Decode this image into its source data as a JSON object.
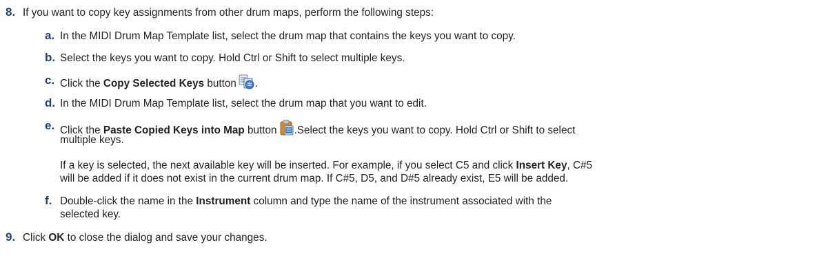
{
  "step8": {
    "num": "8.",
    "text": "If you want to copy key assignments from other drum maps, perform the following steps:"
  },
  "substeps": {
    "a": {
      "letter": "a.",
      "text": "In the MIDI Drum Map Template list, select the drum map that contains the keys you want to copy."
    },
    "b": {
      "letter": "b.",
      "text": "Select the keys you want to copy. Hold Ctrl or Shift to select multiple keys."
    },
    "c": {
      "letter": "c.",
      "pre": "Click the ",
      "bold": "Copy Selected Keys",
      "post": " button",
      "end": ".",
      "icon": "copy-keys-icon"
    },
    "d": {
      "letter": "d.",
      "text": "In the MIDI Drum Map Template list, select the drum map that you want to edit."
    },
    "e": {
      "letter": "e.",
      "pre": "Click the ",
      "bold": "Paste Copied Keys into Map",
      "post": " button",
      "after_icon": ".Select the keys you want to copy. Hold Ctrl or Shift to select",
      "line2": "multiple keys.",
      "icon": "paste-clipboard-icon",
      "para_pre": "If a key is selected, the next available key will be inserted. For example, if you select C5 and click ",
      "para_bold": "Insert Key",
      "para_post": ", C#5",
      "para_line2": "will be added if it does not exist in the current drum map. If C#5, D5, and D#5 already exist, E5 will be added."
    },
    "f": {
      "letter": "f.",
      "pre": "Double-click the name in the ",
      "bold": "Instrument",
      "post": " column and type the name of the instrument associated with the",
      "line2": "selected key."
    }
  },
  "step9": {
    "num": "9.",
    "pre": "Click ",
    "bold": "OK",
    "post": " to close the dialog and save your changes."
  },
  "colors": {
    "step_number": "#1f3f7a",
    "text": "#231f20"
  }
}
